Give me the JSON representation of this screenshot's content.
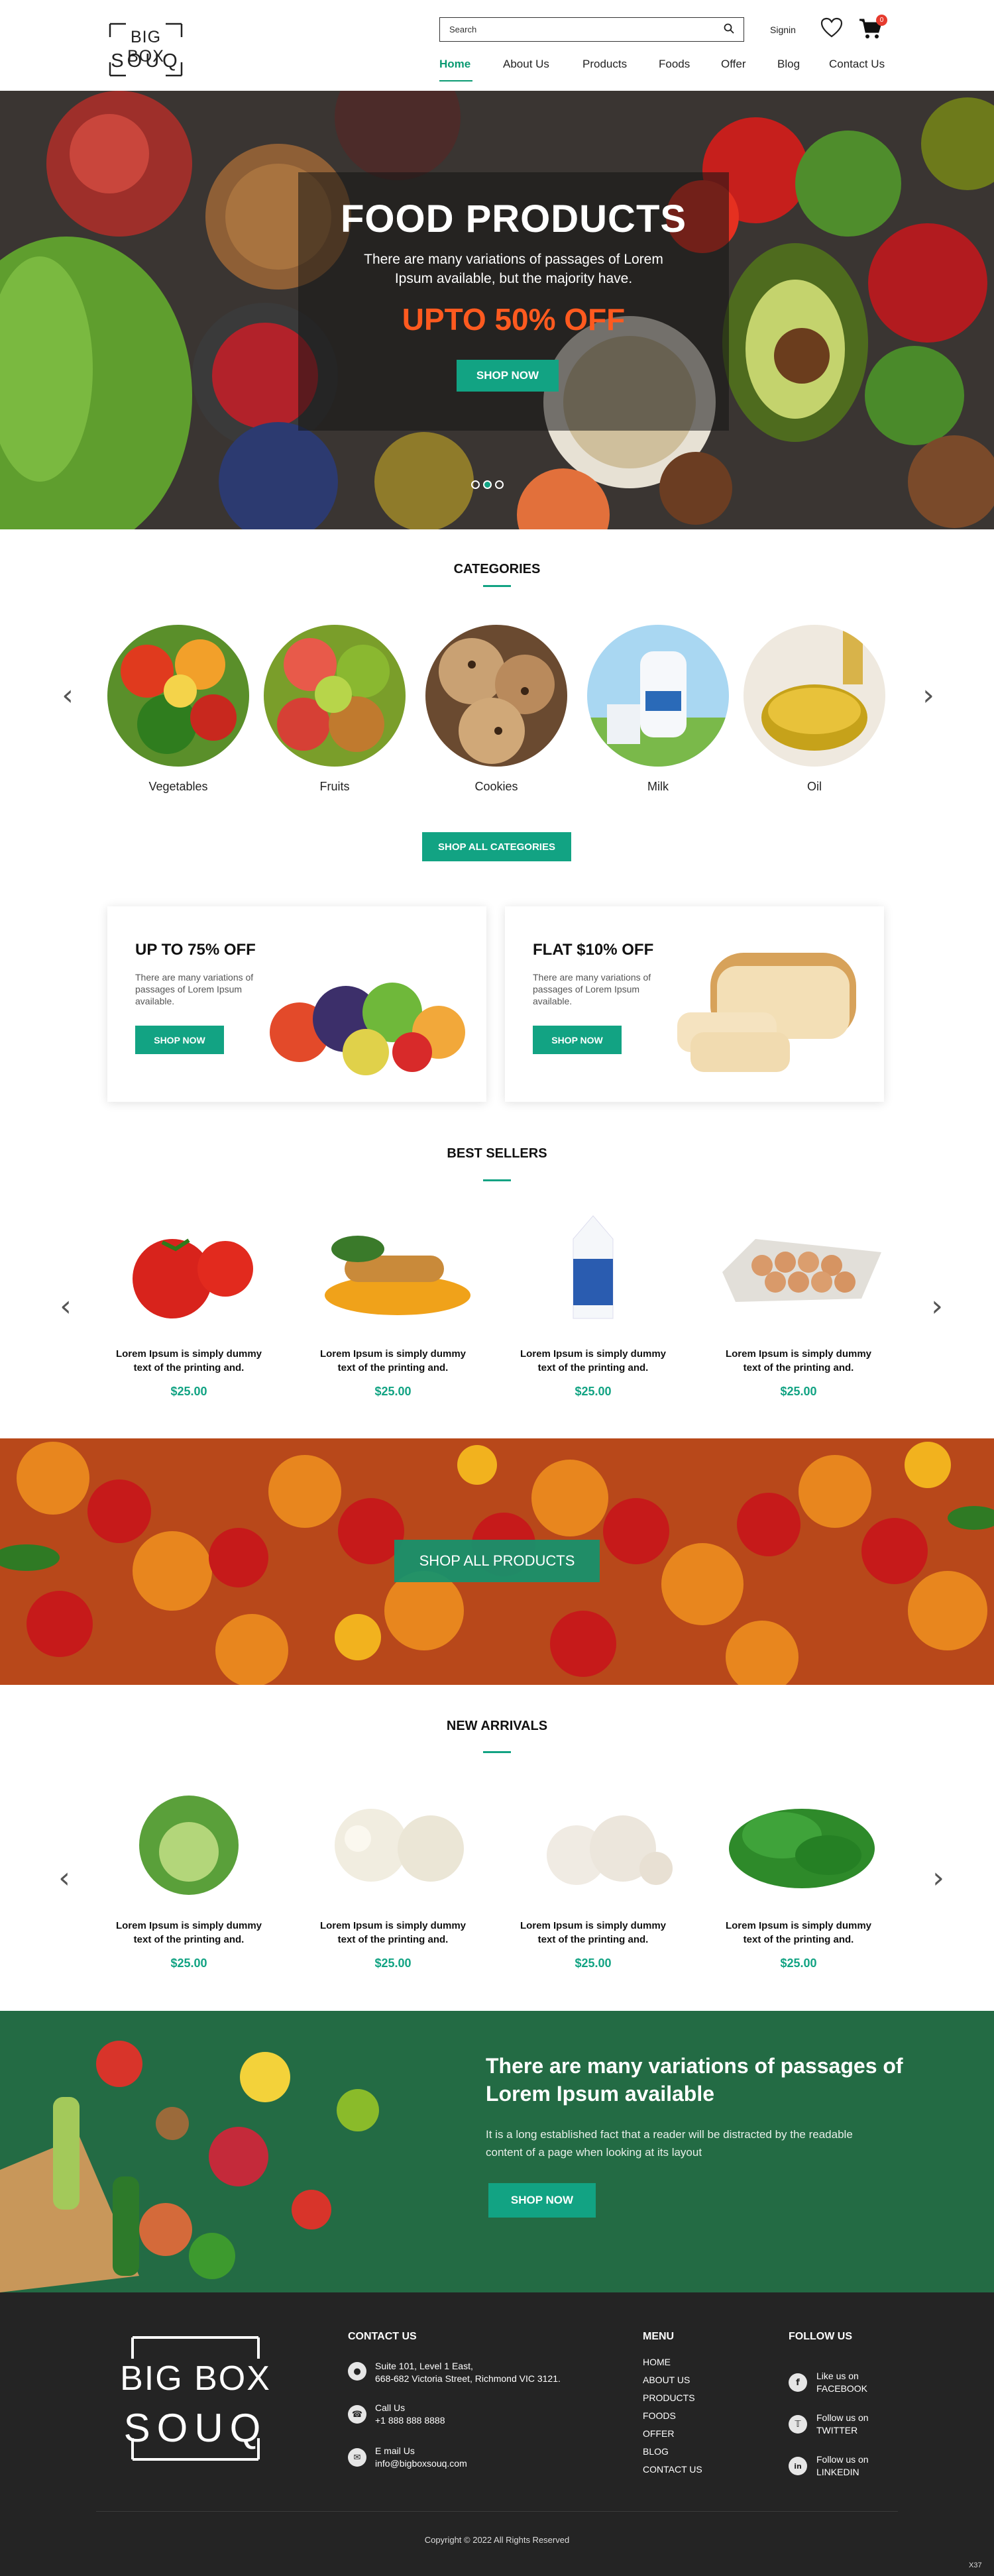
{
  "brand": {
    "line1": "BIG BOX",
    "line2": "SOUQ"
  },
  "header": {
    "search_placeholder": "Search",
    "signin": "Signin",
    "cart_count": "0",
    "nav": [
      {
        "label": "Home",
        "active": true
      },
      {
        "label": "About Us"
      },
      {
        "label": "Products"
      },
      {
        "label": "Foods"
      },
      {
        "label": "Offer"
      },
      {
        "label": "Blog"
      },
      {
        "label": "Contact Us"
      }
    ]
  },
  "hero": {
    "title": "FOOD PRODUCTS",
    "subtitle": "There are many variations of passages of Lorem Ipsum available, but the majority have.",
    "offer": "UPTO 50% OFF",
    "button": "SHOP NOW",
    "slide_count": 3,
    "active_slide": 2
  },
  "categories": {
    "title": "CATEGORIES",
    "items": [
      "Vegetables",
      "Fruits",
      "Cookies",
      "Milk",
      "Oil"
    ],
    "button": "SHOP ALL CATEGORIES"
  },
  "offers": [
    {
      "title": "UP TO 75% OFF",
      "text": "There are many variations of passages of Lorem Ipsum available.",
      "button": "SHOP NOW"
    },
    {
      "title": "FLAT $10% OFF",
      "text": "There are many variations of passages of Lorem Ipsum available.",
      "button": "SHOP NOW"
    }
  ],
  "best_sellers": {
    "title": "BEST SELLERS",
    "items": [
      {
        "name1": "Lorem Ipsum is simply dummy",
        "name2": "text of the printing and.",
        "price": "$25.00"
      },
      {
        "name1": "Lorem Ipsum is simply dummy",
        "name2": "text of the printing and.",
        "price": "$25.00"
      },
      {
        "name1": "Lorem Ipsum is simply dummy",
        "name2": "text of the printing and.",
        "price": "$25.00"
      },
      {
        "name1": "Lorem Ipsum is simply dummy",
        "name2": "text of the printing and.",
        "price": "$25.00"
      }
    ]
  },
  "shop_all_products": "SHOP ALL PRODUCTS",
  "new_arrivals": {
    "title": "NEW ARRIVALS",
    "items": [
      {
        "name1": "Lorem Ipsum is simply dummy",
        "name2": "text of the printing and.",
        "price": "$25.00"
      },
      {
        "name1": "Lorem Ipsum is simply dummy",
        "name2": "text of the printing and.",
        "price": "$25.00"
      },
      {
        "name1": "Lorem Ipsum is simply dummy",
        "name2": "text of the printing and.",
        "price": "$25.00"
      },
      {
        "name1": "Lorem Ipsum is simply dummy",
        "name2": "text of the printing and.",
        "price": "$25.00"
      }
    ]
  },
  "promo": {
    "title": "There are many variations of passages of Lorem Ipsum available",
    "text": "It is a long established fact that a reader will be distracted by the readable content of a page when looking at its layout",
    "button": "SHOP NOW"
  },
  "footer": {
    "contact_title": "CONTACT US",
    "address_line1": "Suite 101, Level 1 East,",
    "address_line2": "668-682 Victoria Street, Richmond VIC 3121.",
    "call_label": "Call Us",
    "phone": "+1 888 888 8888",
    "email_label": "E mail Us",
    "email": "info@bigboxsouq.com",
    "menu_title": "MENU",
    "menu": [
      "HOME",
      "ABOUT US",
      "PRODUCTS",
      "FOODS",
      "OFFER",
      "BLOG",
      "CONTACT US"
    ],
    "follow_title": "FOLLOW US",
    "social": [
      {
        "line1": "Like us on",
        "line2": "FACEBOOK",
        "icon": "facebook-icon"
      },
      {
        "line1": "Follow us on",
        "line2": "TWITTER",
        "icon": "twitter-icon"
      },
      {
        "line1": "Follow us on",
        "line2": "LINKEDIN",
        "icon": "linkedin-icon"
      }
    ],
    "copyright": "Copyright © 2022 All Rights Reserved",
    "corner_tag": "X37"
  },
  "colors": {
    "accent": "#12a383",
    "offer": "#ff5a1f",
    "promo_bg": "#236b44",
    "footer_bg": "#242424"
  }
}
